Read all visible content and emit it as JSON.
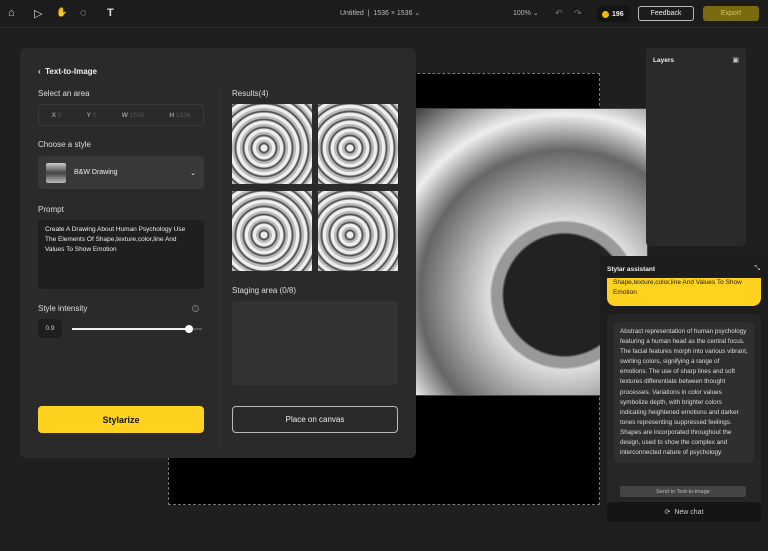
{
  "toolbar": {
    "home": "⌂",
    "select": "▷",
    "hand": "✋",
    "lasso": "◌",
    "text": "T",
    "file_title": "Untitled",
    "dimensions": "1536 × 1536 ⌄",
    "zoom": "100% ⌄",
    "undo": "↶",
    "redo": "↷",
    "coins": "196",
    "feedback": "Feedback",
    "export": "Export"
  },
  "panel": {
    "back": "‹",
    "title": "Text-to-Image",
    "select_area": "Select an area",
    "x_label": "X",
    "x": "0",
    "y_label": "Y",
    "y": "0",
    "w_label": "W",
    "w": "1536",
    "h_label": "H",
    "h": "1536",
    "choose_style": "Choose a style",
    "style": "B&W Drawing",
    "prompt_label": "Prompt",
    "prompt": "Create A Drawing About Human Psychology Use The Elements Of Shape,texture,color,line And Values To Show Emotion",
    "intensity_label": "Style intensity",
    "intensity": "0.9",
    "intensity_fraction": 0.9,
    "stylarize": "Stylarize",
    "results": "Results(4)",
    "staging": "Staging area  (0/8)",
    "place": "Place on canvas"
  },
  "layers": {
    "title": "Layers"
  },
  "assistant": {
    "title": "Stylar assistant",
    "user_msg": "Shape,texture,color,line And Values To Show Emotion",
    "reply": "Abstract representation of human psychology featuring a human head as the central focus. The facial features morph into various vibrant, swirling colors, signifying a range of emotions. The use of sharp lines and soft textures differentiate between thought processes. Variations in color values symbolize depth, with brighter colors indicating heightened emotions and darker tones representing suppressed feelings. Shapes are incorporated throughout the design, used to show the complex and interconnected nature of psychology.",
    "send": "Send to Text-to-image",
    "new_chat": "New chat"
  }
}
